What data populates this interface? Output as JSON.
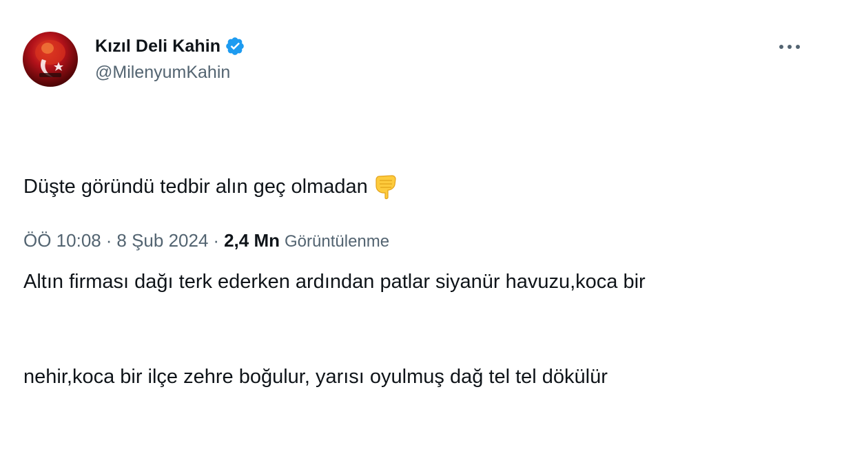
{
  "author": {
    "display_name": "Kızıl Deli Kahin",
    "handle": "@MilenyumKahin",
    "verified": true
  },
  "tweet": {
    "lines": [
      "Düşte göründü tedbir alın geç olmadan",
      "Altın firması dağı terk ederken ardından patlar siyanür havuzu,koca bir",
      "nehir,koca bir ilçe zehre boğulur, yarısı oyulmuş dağ tel tel dökülür"
    ],
    "emoji_icon": "backhand-index-pointing-down-icon"
  },
  "meta": {
    "time": "ÖÖ 10:08",
    "separator": "·",
    "date": "8 Şub 2024",
    "views_count": "2,4 Mn",
    "views_label": "Görüntülenme"
  },
  "icons": {
    "more": "more-horizontal-icon",
    "verified": "verified-badge-icon"
  },
  "colors": {
    "text_primary": "#0f1419",
    "text_secondary": "#536471",
    "verified_blue": "#1d9bf0"
  }
}
